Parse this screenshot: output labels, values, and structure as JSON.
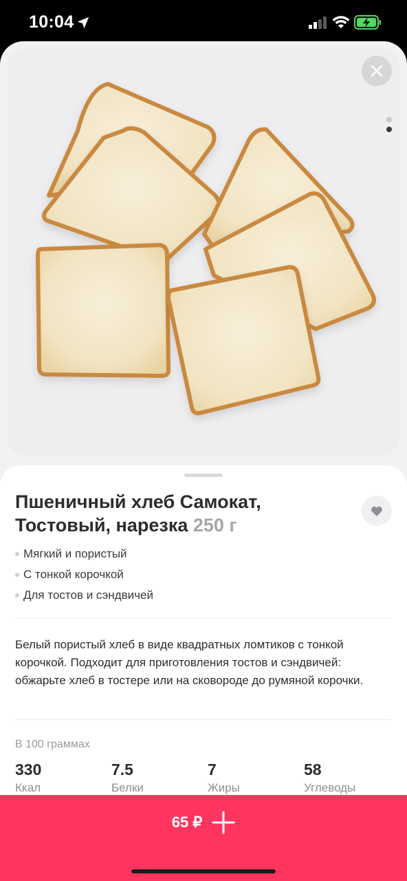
{
  "status_bar": {
    "time": "10:04",
    "icons": [
      "location-arrow-icon",
      "cellular-signal-icon",
      "wifi-icon",
      "battery-charging-icon"
    ],
    "battery_color": "#4cd964"
  },
  "gallery": {
    "image": "sliced-white-bread",
    "page_count": 2,
    "current_page": 2
  },
  "product": {
    "title": "Пшеничный хлеб Самокат, Тостовый, нарезка",
    "weight": "250 г",
    "features": [
      "Мягкий и пористый",
      "С тонкой корочкой",
      "Для тостов и сэндвичей"
    ],
    "description": "Белый пористый хлеб в виде квадратных ломтиков с тонкой корочкой. Подходит для приготовления тостов и сэндвичей: обжарьте хлеб в тостере или на сковороде до румяной корочки."
  },
  "nutrition": {
    "caption": "В 100 граммах",
    "items": [
      {
        "value": "330",
        "label": "Ккал"
      },
      {
        "value": "7.5",
        "label": "Белки"
      },
      {
        "value": "7",
        "label": "Жиры"
      },
      {
        "value": "58",
        "label": "Углеводы"
      }
    ]
  },
  "cart": {
    "price": "65 ₽",
    "accent_color": "#ff3560"
  }
}
